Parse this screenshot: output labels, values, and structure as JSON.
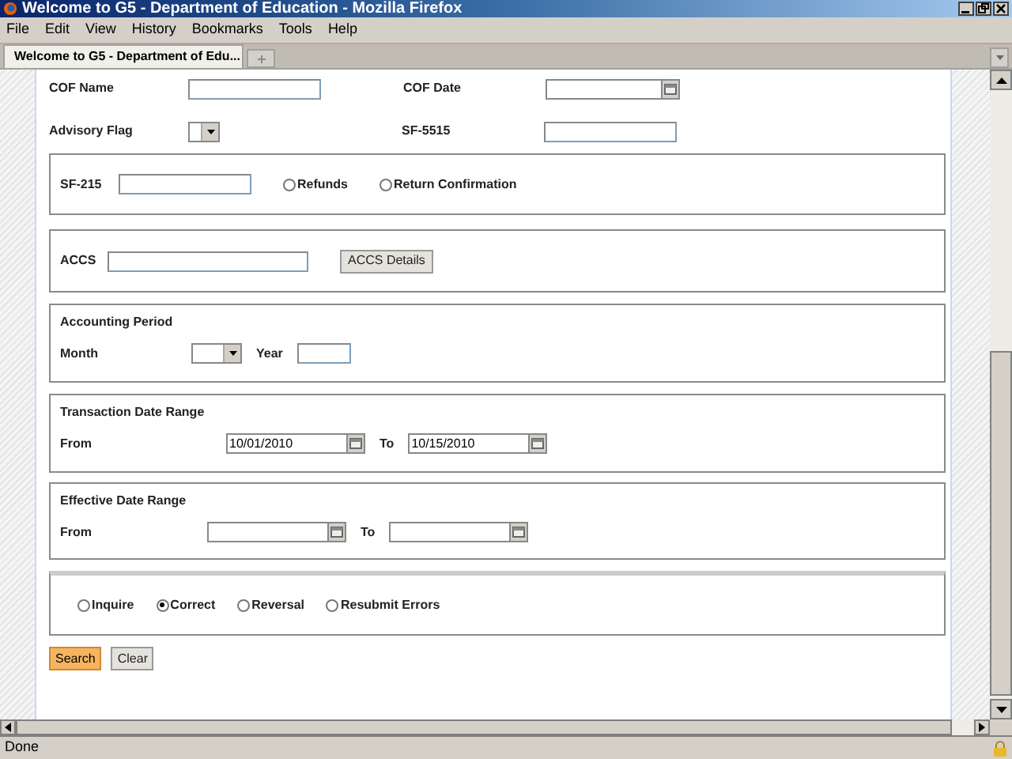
{
  "window": {
    "title": "Welcome to G5 - Department of Education - Mozilla Firefox"
  },
  "menu": [
    "File",
    "Edit",
    "View",
    "History",
    "Bookmarks",
    "Tools",
    "Help"
  ],
  "tabs": [
    {
      "label": "Welcome to G5 - Department of Edu...",
      "selected": true
    }
  ],
  "top_fields": [
    {
      "label": "COF Name",
      "kind": "text"
    },
    {
      "label": "COF Date",
      "kind": "date"
    },
    {
      "label": "Advisory Flag",
      "kind": "select"
    },
    {
      "label": "SF-5515",
      "kind": "text"
    }
  ],
  "sections": [
    {
      "items": [
        {
          "kind": "label",
          "text": "SF-215"
        },
        {
          "kind": "text"
        },
        {
          "kind": "radio",
          "label": "Refunds",
          "selected": false
        },
        {
          "kind": "radio",
          "label": "Return Confirmation",
          "selected": false
        }
      ]
    },
    {
      "items": [
        {
          "kind": "label",
          "text": "ACCS"
        },
        {
          "kind": "text"
        },
        {
          "kind": "button",
          "label": "ACCS Details"
        }
      ]
    },
    {
      "title": "Accounting Period",
      "items": [
        {
          "kind": "label",
          "text": "Month"
        },
        {
          "kind": "select"
        },
        {
          "kind": "label",
          "text": "Year"
        },
        {
          "kind": "text"
        }
      ]
    },
    {
      "title": "Transaction Date Range",
      "items": [
        {
          "kind": "label",
          "text": "From"
        },
        {
          "kind": "date",
          "value": "10/01/2010"
        },
        {
          "kind": "label",
          "text": "To"
        },
        {
          "kind": "date",
          "value": "10/15/2010"
        }
      ]
    },
    {
      "title": "Effective Date Range",
      "items": [
        {
          "kind": "label",
          "text": "From"
        },
        {
          "kind": "date"
        },
        {
          "kind": "label",
          "text": "To"
        },
        {
          "kind": "date"
        }
      ]
    },
    {
      "items": [
        {
          "kind": "radio",
          "label": "Inquire",
          "selected": false
        },
        {
          "kind": "radio",
          "label": "Correct",
          "selected": true
        },
        {
          "kind": "radio",
          "label": "Reversal",
          "selected": false
        },
        {
          "kind": "radio",
          "label": "Resubmit Errors",
          "selected": false
        }
      ]
    }
  ],
  "buttons": [
    {
      "label": "Search",
      "primary": true
    },
    {
      "label": "Clear",
      "primary": false
    }
  ],
  "status_bar": {
    "text": "Done"
  }
}
